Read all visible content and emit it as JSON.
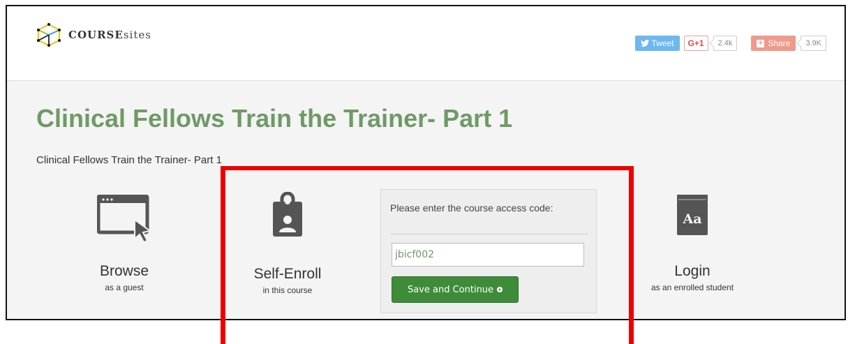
{
  "header": {
    "logo_text_bold": "COURSE",
    "logo_text_light": "sites",
    "social": {
      "tweet_label": "Tweet",
      "gplus_label": "G+1",
      "gplus_count": "2.4k",
      "share_label": "Share",
      "share_count": "3.9K"
    }
  },
  "page": {
    "title": "Clinical Fellows Train the Trainer- Part 1",
    "description": "Clinical Fellows Train the Trainer- Part 1"
  },
  "options": {
    "browse": {
      "label": "Browse",
      "sub": "as a guest",
      "icon": "browser-window-cursor-icon"
    },
    "enroll": {
      "label": "Self-Enroll",
      "sub": "in this course",
      "icon": "id-badge-icon"
    },
    "login": {
      "label": "Login",
      "sub": "as an enrolled student",
      "icon": "book-icon"
    }
  },
  "form": {
    "label": "Please enter the course access code:",
    "code_value": "jbicf002",
    "save_label": "Save and Continue"
  },
  "colors": {
    "title_green": "#6f9a66",
    "button_green": "#3e8c3a",
    "highlight_red": "#ee0000",
    "tweet_blue": "#55acee",
    "share_salmon": "#ef9a8c"
  }
}
